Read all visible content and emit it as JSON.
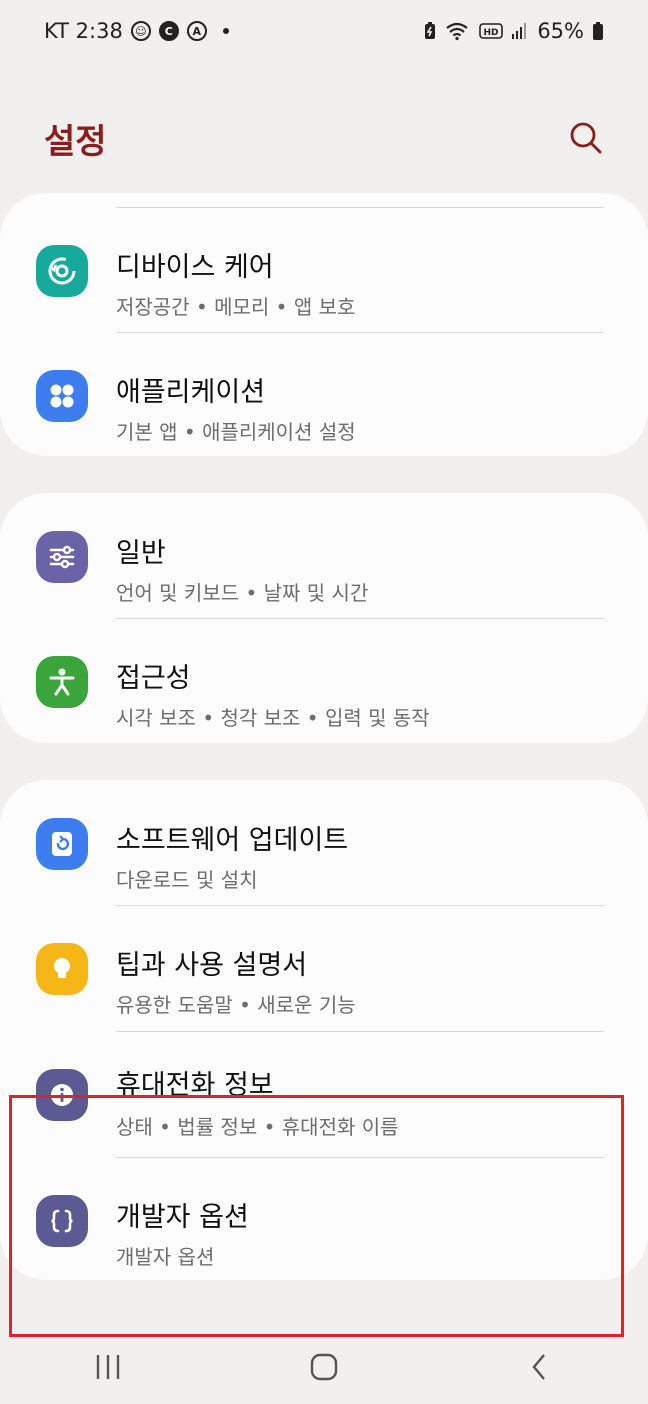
{
  "status_bar": {
    "carrier_time": "KT 2:38",
    "battery": "65%",
    "icons": [
      "location-icon",
      "c-icon",
      "a-icon",
      "dot",
      "battery-saver-icon",
      "wifi-icon",
      "hd-icon",
      "signal-icon",
      "battery-icon"
    ]
  },
  "header": {
    "title": "설정",
    "search_icon": "search-icon"
  },
  "colors": {
    "title": "#8b1d1d",
    "device_care": "#17a99b",
    "apps": "#3d7df0",
    "general": "#6a63a8",
    "accessibility": "#3aa53b",
    "software_update": "#3d7df0",
    "tips": "#f5b617",
    "phone_info": "#5c5a93",
    "developer": "#5c5a93",
    "highlight": "#e32128"
  },
  "settings": {
    "device_care": {
      "title": "디바이스 케어",
      "subtitle": "저장공간 • 메모리 • 앱 보호"
    },
    "apps": {
      "title": "애플리케이션",
      "subtitle": "기본 앱 • 애플리케이션 설정"
    },
    "general": {
      "title": "일반",
      "subtitle": "언어 및 키보드 • 날짜 및 시간"
    },
    "accessibility": {
      "title": "접근성",
      "subtitle": "시각 보조 • 청각 보조 • 입력 및 동작"
    },
    "software_update": {
      "title": "소프트웨어 업데이트",
      "subtitle": "다운로드 및 설치"
    },
    "tips": {
      "title": "팁과 사용 설명서",
      "subtitle": "유용한 도움말 • 새로운 기능"
    },
    "phone_info": {
      "title": "휴대전화 정보",
      "subtitle": "상태 • 법률 정보 • 휴대전화 이름"
    },
    "developer": {
      "title": "개발자 옵션",
      "subtitle": "개발자 옵션"
    }
  },
  "nav_bar": {
    "recents": "recents-icon",
    "home": "home-icon",
    "back": "back-icon"
  }
}
